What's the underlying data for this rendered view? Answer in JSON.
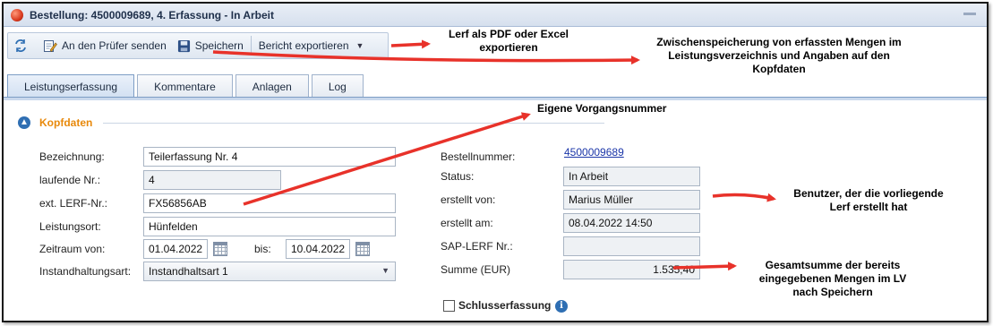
{
  "window": {
    "title": "Bestellung: 4500009689, 4. Erfassung - In Arbeit"
  },
  "toolbar": {
    "send_label": "An den Prüfer senden",
    "save_label": "Speichern",
    "export_label": "Bericht exportieren"
  },
  "tabs": [
    {
      "label": "Leistungserfassung",
      "active": true
    },
    {
      "label": "Kommentare",
      "active": false
    },
    {
      "label": "Anlagen",
      "active": false
    },
    {
      "label": "Log",
      "active": false
    }
  ],
  "section": {
    "title": "Kopfdaten"
  },
  "form_left": {
    "bezeichnung_label": "Bezeichnung:",
    "bezeichnung_value": "Teilerfassung Nr. 4",
    "laufende_label": "laufende Nr.:",
    "laufende_value": "4",
    "extlerf_label": "ext. LERF-Nr.:",
    "extlerf_value": "FX56856AB",
    "leistungsort_label": "Leistungsort:",
    "leistungsort_value": "Hünfelden",
    "zeitraum_label": "Zeitraum von:",
    "zeitraum_von": "01.04.2022",
    "bis_label": "bis:",
    "zeitraum_bis": "10.04.2022",
    "instandhaltungsart_label": "Instandhaltungsart:",
    "instandhaltungsart_value": "Instandhaltsart 1"
  },
  "form_right": {
    "bestellnummer_label": "Bestellnummer:",
    "bestellnummer_value": "4500009689",
    "status_label": "Status:",
    "status_value": "In Arbeit",
    "erstellt_von_label": "erstellt von:",
    "erstellt_von_value": "Marius Müller",
    "erstellt_am_label": "erstellt am:",
    "erstellt_am_value": "08.04.2022 14:50",
    "saplerf_label": "SAP-LERF Nr.:",
    "saplerf_value": "",
    "summe_label": "Summe (EUR)",
    "summe_value": "1.535,40",
    "schluss_label": "Schlusserfassung",
    "schluss_checked": false
  },
  "annotations": {
    "export_line1": "Lerf als PDF oder Excel",
    "export_line2": "exportieren",
    "save_line1": "Zwischenspeicherung von erfassten Mengen im",
    "save_line2": "Leistungsverzeichnis und Angaben auf den",
    "save_line3": "Kopfdaten",
    "vorgang": "Eigene Vorgangsnummer",
    "benutzer_line1": "Benutzer, der die vorliegende",
    "benutzer_line2": "Lerf erstellt hat",
    "summe_line1": "Gesamtsumme der bereits",
    "summe_line2": "eingegebenen Mengen im LV",
    "summe_line3": "nach Speichern"
  },
  "colors": {
    "accent_orange": "#e8890b",
    "arrow_red": "#e8322a",
    "link_blue": "#1a35a8"
  }
}
